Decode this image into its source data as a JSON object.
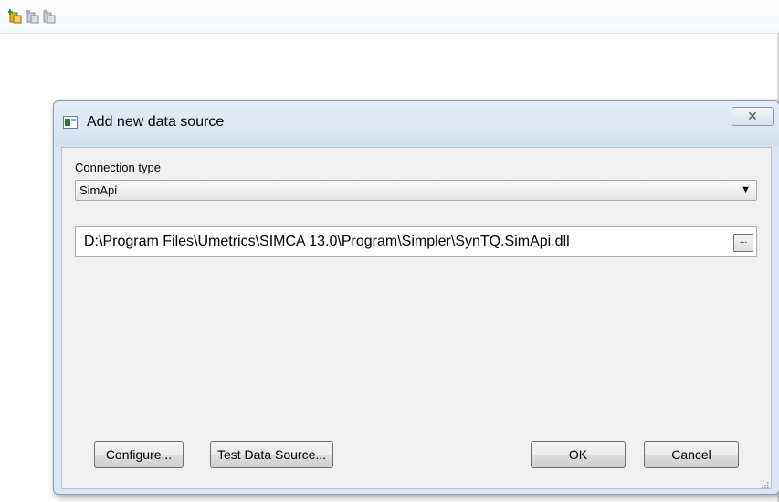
{
  "dialog": {
    "title": "Add new data source",
    "close_glyph": "✕",
    "connection_label": "Connection type",
    "connection_value": "SimApi",
    "path_value": "D:\\Program Files\\Umetrics\\SIMCA 13.0\\Program\\Simpler\\SynTQ.SimApi.dll",
    "browse_label": "...",
    "buttons": {
      "configure": "Configure...",
      "test": "Test Data Source...",
      "ok": "OK",
      "cancel": "Cancel"
    }
  },
  "icons": {
    "toolbar": [
      "add-data-source-icon",
      "edit-data-source-icon",
      "remove-data-source-icon"
    ],
    "dialog": "dialog-app-icon"
  },
  "colors": {
    "dialog_frame": "#dae6f3",
    "client_bg": "#f0f0f0",
    "toolbar_active": "#e3b21a"
  }
}
